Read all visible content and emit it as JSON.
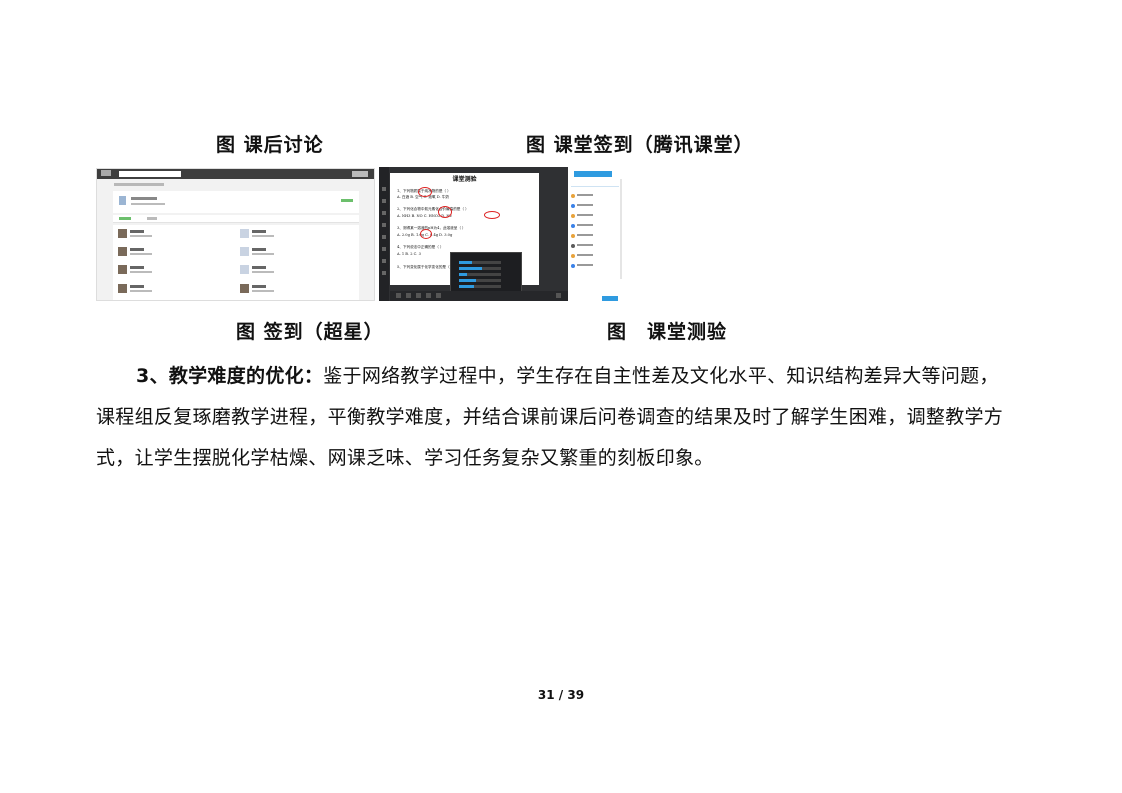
{
  "captions": {
    "top_left": "图 课后讨论",
    "top_right": "图 课堂签到（腾讯课堂）",
    "bottom_left": "图 签到（超星）",
    "bottom_right": "图　课堂测验"
  },
  "quiz": {
    "title": "课堂测验",
    "lines": [
      "1、下列物质属于纯净物的是（ ）",
      "A. 白酒  B. 空气  C. 液氧  D. 牛奶",
      "2、下列化合物中氮元素化合价最高的是（ ）",
      "A. NH3  B. NO  C. HNO3  D. N2",
      "3、测得某一溶液的pH为4，此溶液呈（ ）",
      "A. 2.0g  B. 1.0g  C. 0.4g  D. 3.0g",
      "4、下列说法中正确的是（ ）",
      "A. 1   B. 2   C. 3",
      "5、下列变化属于化学变化的是（ ）"
    ]
  },
  "paragraph": {
    "lead": "3、教学难度的优化：",
    "line1": "鉴于网络教学过程中，学生存在自主性差及文化水平、知识结构差异大等问题，",
    "line2": "课程组反复琢磨教学进程，平衡教学难度，并结合课前课后问卷调查的结果及时了解学生困难，调整教学方",
    "line3": "式，让学生摆脱化学枯燥、网课乏味、学习任务复杂又繁重的刻板印象。"
  },
  "footer": {
    "page_number": "31 / 39"
  },
  "colors": {
    "accent_blue": "#2f9be0",
    "signin_green": "#6cbf6c",
    "annotation_red": "#d22222"
  }
}
